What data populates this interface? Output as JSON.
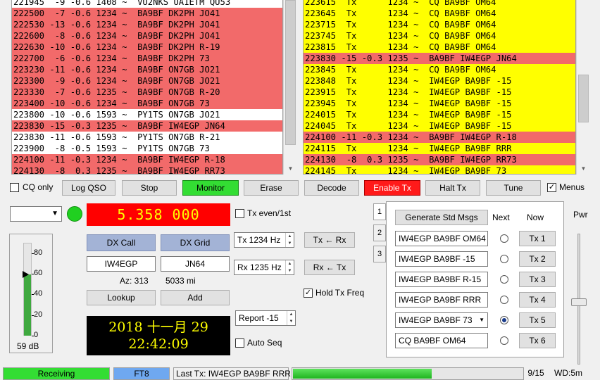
{
  "left_lines": [
    {
      "text": "221945  -9 -0.6 1408 ~  VU2NKS UA1ETM QU53",
      "color": "white"
    },
    {
      "text": "222500  -7 -0.6 1234 ~  BA9BF DK2PH JO41",
      "color": "red"
    },
    {
      "text": "222530 -13 -0.6 1234 ~  BA9BF DK2PH JO41",
      "color": "red"
    },
    {
      "text": "222600  -8 -0.6 1234 ~  BA9BF DK2PH JO41",
      "color": "red"
    },
    {
      "text": "222630 -10 -0.6 1234 ~  BA9BF DK2PH R-19",
      "color": "red"
    },
    {
      "text": "222700  -6 -0.6 1234 ~  BA9BF DK2PH 73",
      "color": "red"
    },
    {
      "text": "223230 -11 -0.6 1234 ~  BA9BF ON7GB JO21",
      "color": "red"
    },
    {
      "text": "223300  -9 -0.6 1234 ~  BA9BF ON7GB JO21",
      "color": "red"
    },
    {
      "text": "223330  -7 -0.6 1235 ~  BA9BF ON7GB R-20",
      "color": "red"
    },
    {
      "text": "223400 -10 -0.6 1234 ~  BA9BF ON7GB 73",
      "color": "red"
    },
    {
      "text": "223800 -10 -0.6 1593 ~  PY1TS ON7GB JO21",
      "color": "white"
    },
    {
      "text": "223830 -15 -0.3 1235 ~  BA9BF IW4EGP JN64",
      "color": "red"
    },
    {
      "text": "223830 -11 -0.6 1593 ~  PY1TS ON7GB R-21",
      "color": "white"
    },
    {
      "text": "223900  -8 -0.5 1593 ~  PY1TS ON7GB 73",
      "color": "white"
    },
    {
      "text": "224100 -11 -0.3 1234 ~  BA9BF IW4EGP R-18",
      "color": "red"
    },
    {
      "text": "224130  -8  0.3 1235 ~  BA9BF IW4EGP RR73",
      "color": "red"
    }
  ],
  "right_lines": [
    {
      "text": "223615  Tx      1234 ~  CQ BA9BF OM64",
      "color": "yellow"
    },
    {
      "text": "223645  Tx      1234 ~  CQ BA9BF OM64",
      "color": "yellow"
    },
    {
      "text": "223715  Tx      1234 ~  CQ BA9BF OM64",
      "color": "yellow"
    },
    {
      "text": "223745  Tx      1234 ~  CQ BA9BF OM64",
      "color": "yellow"
    },
    {
      "text": "223815  Tx      1234 ~  CQ BA9BF OM64",
      "color": "yellow"
    },
    {
      "text": "223830 -15 -0.3 1235 ~  BA9BF IW4EGP JN64",
      "color": "red"
    },
    {
      "text": "223845  Tx      1234 ~  CQ BA9BF OM64",
      "color": "yellow"
    },
    {
      "text": "223848  Tx      1234 ~  IW4EGP BA9BF -15",
      "color": "yellow"
    },
    {
      "text": "223915  Tx      1234 ~  IW4EGP BA9BF -15",
      "color": "yellow"
    },
    {
      "text": "223945  Tx      1234 ~  IW4EGP BA9BF -15",
      "color": "yellow"
    },
    {
      "text": "224015  Tx      1234 ~  IW4EGP BA9BF -15",
      "color": "yellow"
    },
    {
      "text": "224045  Tx      1234 ~  IW4EGP BA9BF -15",
      "color": "yellow"
    },
    {
      "text": "224100 -11 -0.3 1234 ~  BA9BF IW4EGP R-18",
      "color": "red"
    },
    {
      "text": "224115  Tx      1234 ~  IW4EGP BA9BF RRR",
      "color": "yellow"
    },
    {
      "text": "224130  -8  0.3 1235 ~  BA9BF IW4EGP RR73",
      "color": "red"
    },
    {
      "text": "224145  Tx      1234 ~  IW4EGP BA9BF 73",
      "color": "yellow"
    }
  ],
  "controls": {
    "cq_only": "CQ only",
    "log_qso": "Log QSO",
    "stop": "Stop",
    "monitor": "Monitor",
    "erase": "Erase",
    "decode": "Decode",
    "enable_tx": "Enable Tx",
    "halt_tx": "Halt Tx",
    "tune": "Tune",
    "menus": "Menus",
    "menus_checked": true
  },
  "freq": "5.358  000",
  "tx_even": "Tx even/1st",
  "dx": {
    "call_label": "DX Call",
    "grid_label": "DX Grid",
    "call": "IW4EGP",
    "grid": "JN64",
    "az": "Az: 313",
    "dist": "5033 mi",
    "lookup": "Lookup",
    "add": "Add"
  },
  "tx_freq": "Tx  1234  Hz",
  "rx_freq": "Rx  1235  Hz",
  "tx_from_rx": "Tx ← Rx",
  "rx_from_tx": "Rx ← Tx",
  "hold_tx": "Hold Tx Freq",
  "report": "Report -15",
  "auto_seq": "Auto Seq",
  "clock": {
    "date": "2018  十一月  29",
    "time": "22:42:09"
  },
  "meter": {
    "ticks": [
      "80",
      "60",
      "40",
      "20",
      "0"
    ],
    "level_db": 59,
    "reading": "59 dB"
  },
  "tabs": [
    "1",
    "2",
    "3"
  ],
  "tx_panel": {
    "generate": "Generate Std Msgs",
    "next_label": "Next",
    "now_label": "Now",
    "messages": [
      "IW4EGP BA9BF OM64",
      "IW4EGP BA9BF -15",
      "IW4EGP BA9BF R-15",
      "IW4EGP BA9BF RRR",
      "IW4EGP BA9BF 73",
      "CQ BA9BF OM64"
    ],
    "buttons": [
      "Tx 1",
      "Tx 2",
      "Tx 3",
      "Tx 4",
      "Tx 5",
      "Tx 6"
    ],
    "selected": 4
  },
  "pwr": "Pwr",
  "status": {
    "receiving": "Receiving",
    "mode": "FT8",
    "last_tx": "Last Tx: IW4EGP BA9BF RRR",
    "progress": "9/15",
    "progress_fraction": 0.6,
    "wd": "WD:5m"
  },
  "colors": {
    "red_row": "#f26a6a",
    "yellow_row": "#ffff00",
    "monitor_green": "#33dd33",
    "enable_tx_red": "#ff1a1a"
  }
}
